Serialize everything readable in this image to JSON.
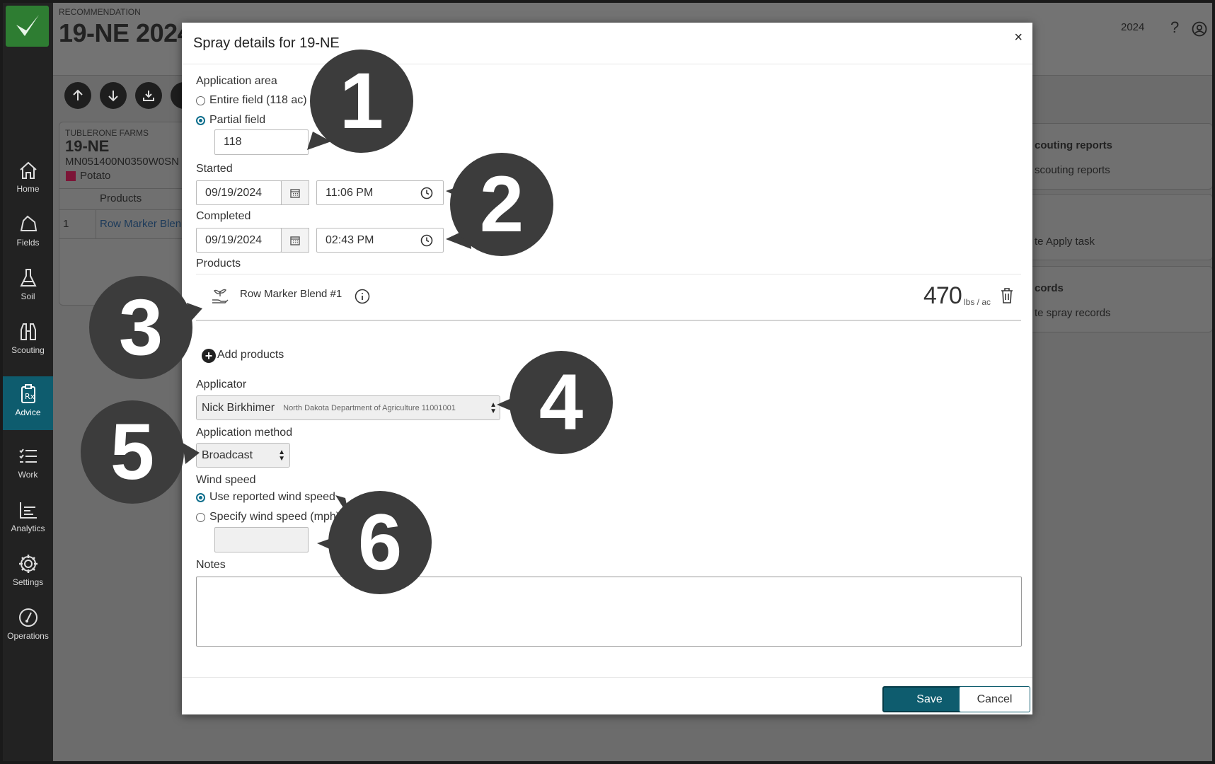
{
  "sidebar": {
    "items": [
      {
        "label": "Home",
        "icon": "home-icon"
      },
      {
        "label": "Fields",
        "icon": "fields-icon"
      },
      {
        "label": "Soil",
        "icon": "flask-icon"
      },
      {
        "label": "Scouting",
        "icon": "binoculars-icon"
      },
      {
        "label": "Advice",
        "icon": "prescription-icon",
        "active": true
      },
      {
        "label": "Work",
        "icon": "checklist-icon"
      },
      {
        "label": "Analytics",
        "icon": "chart-icon"
      },
      {
        "label": "Settings",
        "icon": "gear-icon"
      },
      {
        "label": "Operations",
        "icon": "gauge-icon"
      }
    ]
  },
  "header": {
    "kicker": "RECOMMENDATION",
    "title": "19-NE 2024",
    "year": "2024",
    "help_icon": "question-icon",
    "account_icon": "user-circle-icon"
  },
  "background": {
    "farm": "TUBLERONE FARMS",
    "field": "19-NE",
    "field_code": "MN051400N0350W0SN",
    "crop": "Potato",
    "crop_color": "#c2185b",
    "products_header": "Products",
    "row_number": "1",
    "row_product": "Row Marker Blen",
    "cards": [
      {
        "title": "couting reports",
        "link": "scouting reports"
      },
      {
        "title": "",
        "link": "te Apply task"
      },
      {
        "title": "cords",
        "link": "te spray records"
      }
    ]
  },
  "modal": {
    "title": "Spray details for 19-NE",
    "close": "×",
    "application_area": {
      "label": "Application area",
      "option_entire": "Entire field (118 ac)",
      "option_partial": "Partial field",
      "selected": "partial",
      "partial_value": "118"
    },
    "started": {
      "label": "Started",
      "date": "09/19/2024",
      "time": "11:06 PM"
    },
    "completed": {
      "label": "Completed",
      "date": "09/19/2024",
      "time": "02:43 PM"
    },
    "products": {
      "label": "Products",
      "items": [
        {
          "name": "Row Marker Blend #1",
          "rate": "470",
          "unit": "lbs / ac"
        }
      ],
      "add_label": "Add products"
    },
    "applicator": {
      "label": "Applicator",
      "name": "Nick Birkhimer",
      "detail": "North Dakota Department of Agriculture 11001001"
    },
    "application_method": {
      "label": "Application method",
      "value": "Broadcast"
    },
    "wind_speed": {
      "label": "Wind speed",
      "option_reported": "Use reported wind speed",
      "option_specify": "Specify wind speed (mph)",
      "selected": "reported",
      "value": ""
    },
    "notes": {
      "label": "Notes",
      "value": ""
    },
    "save_label": "Save",
    "cancel_label": "Cancel"
  },
  "callouts": [
    "1",
    "2",
    "3",
    "4",
    "5",
    "6"
  ]
}
